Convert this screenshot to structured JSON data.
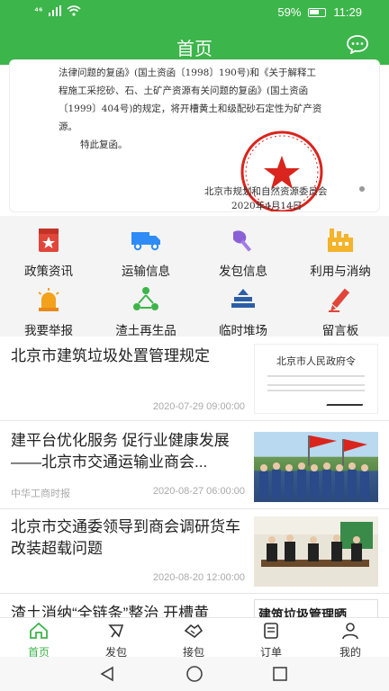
{
  "status": {
    "signal": "⁴⁶",
    "battery": "59%",
    "time": "11:29"
  },
  "header": {
    "title": "首页"
  },
  "banner": {
    "doc_lines": [
      "法律问题的复函》(国土资函〔1998〕190号)和《关于解释工",
      "程施工采挖砂、石、土矿产资源有关问题的复函》(国土资函",
      "〔1999〕404号)的规定，将开槽黄土和级配砂石定性为矿产资",
      "源。",
      "特此复函。"
    ],
    "signer": "北京市规划和自然资源委员会",
    "date": "2020年4月14日"
  },
  "grid": [
    {
      "label": "政策资讯",
      "icon": "policy-icon"
    },
    {
      "label": "运输信息",
      "icon": "truck-icon"
    },
    {
      "label": "发包信息",
      "icon": "shovel-icon"
    },
    {
      "label": "利用与消纳",
      "icon": "factory-icon"
    },
    {
      "label": "我要举报",
      "icon": "alarm-icon"
    },
    {
      "label": "渣土再生品",
      "icon": "recycle-icon"
    },
    {
      "label": "临时堆场",
      "icon": "stack-icon"
    },
    {
      "label": "留言板",
      "icon": "pen-icon"
    }
  ],
  "news": [
    {
      "title": "北京市建筑垃圾处置管理规定",
      "source": "",
      "date": "2020-07-29 09:00:00",
      "thumb_text": "北京市人民政府令"
    },
    {
      "title": "建平台优化服务 促行业健康发展——北京市交通运输业商会...",
      "source": "中华工商时报",
      "date": "2020-08-27 06:00:00"
    },
    {
      "title": "北京市交通委领导到商会调研货车改装超载问题",
      "source": "",
      "date": "2020-08-20 12:00:00"
    },
    {
      "title": "渣土消纳“全链条”整治 开槽黄",
      "source": "",
      "date": "",
      "thumb_text": "建筑垃圾管理晒在“阳光”下"
    }
  ],
  "tabs": [
    {
      "label": "首页",
      "icon": "home-icon",
      "active": true
    },
    {
      "label": "发包",
      "icon": "send-icon"
    },
    {
      "label": "接包",
      "icon": "handshake-icon"
    },
    {
      "label": "订单",
      "icon": "order-icon"
    },
    {
      "label": "我的",
      "icon": "user-icon"
    }
  ],
  "colors": {
    "brand": "#3cb54a",
    "seal": "#d9251d"
  }
}
